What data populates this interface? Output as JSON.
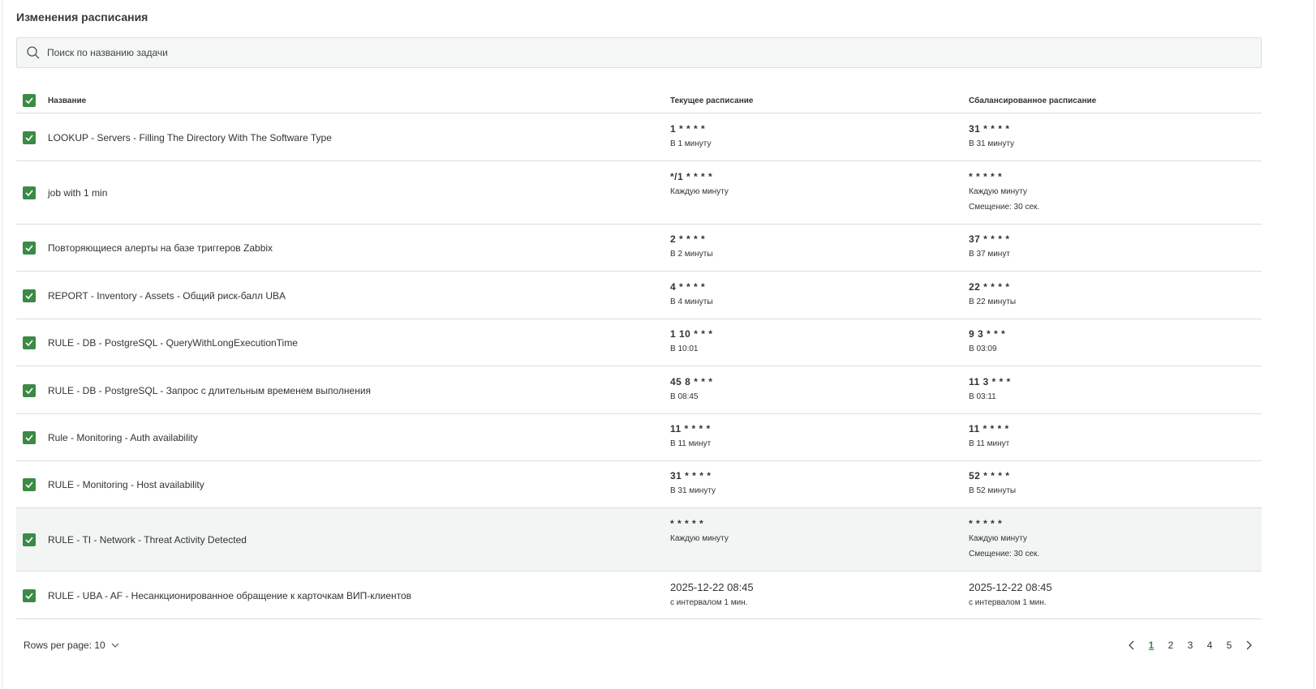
{
  "title": "Изменения расписания",
  "search": {
    "placeholder": "Поиск по названию задачи",
    "value": ""
  },
  "colors": {
    "accent": "#3b8a45"
  },
  "header": {
    "name": "Название",
    "current": "Текущее расписание",
    "balanced": "Сбалансированное расписание"
  },
  "rows": [
    {
      "name": "LOOKUP - Servers - Filling The Directory With The Software Type",
      "current": {
        "cron": "1 * * * *",
        "desc": "В 1 минуту"
      },
      "balanced": {
        "cron": "31 * * * *",
        "desc": "В 31 минуту"
      }
    },
    {
      "name": "job with 1 min",
      "current": {
        "cron": "*/1 * * * *",
        "desc": "Каждую минуту"
      },
      "balanced": {
        "cron": "* * * * *",
        "desc": "Каждую минуту",
        "offset": "Смещение: 30 сек."
      }
    },
    {
      "name": "Повторяющиеся алерты на базе триггеров Zabbix",
      "current": {
        "cron": "2 * * * *",
        "desc": "В 2 минуты"
      },
      "balanced": {
        "cron": "37 * * * *",
        "desc": "В 37 минут"
      }
    },
    {
      "name": "REPORT - Inventory - Assets - Общий риск-балл UBA",
      "current": {
        "cron": "4 * * * *",
        "desc": "В 4 минуты"
      },
      "balanced": {
        "cron": "22 * * * *",
        "desc": "В 22 минуты"
      }
    },
    {
      "name": "RULE - DB - PostgreSQL - QueryWithLongExecutionTime",
      "current": {
        "cron": "1 10 * * *",
        "desc": "В 10:01"
      },
      "balanced": {
        "cron": "9 3 * * *",
        "desc": "В 03:09"
      }
    },
    {
      "name": "RULE - DB - PostgreSQL - Запрос с длительным временем выполнения",
      "current": {
        "cron": "45 8 * * *",
        "desc": "В 08:45"
      },
      "balanced": {
        "cron": "11 3 * * *",
        "desc": "В 03:11"
      }
    },
    {
      "name": "Rule - Monitoring - Auth availability",
      "current": {
        "cron": "11 * * * *",
        "desc": "В 11 минут"
      },
      "balanced": {
        "cron": "11 * * * *",
        "desc": "В 11 минут"
      }
    },
    {
      "name": "RULE - Monitoring - Host availability",
      "current": {
        "cron": "31 * * * *",
        "desc": "В 31 минуту"
      },
      "balanced": {
        "cron": "52 * * * *",
        "desc": "В 52 минуты"
      }
    },
    {
      "name": "RULE - TI - Network - Threat Activity Detected",
      "current": {
        "cron": "* * * * *",
        "desc": "Каждую минуту"
      },
      "balanced": {
        "cron": "* * * * *",
        "desc": "Каждую минуту",
        "offset": "Смещение: 30 сек."
      }
    },
    {
      "name": "RULE - UBA - AF - Несанкционированное обращение к карточкам ВИП-клиентов",
      "current": {
        "cron": "2025-12-22 08:45",
        "desc": "с интервалом 1 мин."
      },
      "balanced": {
        "cron": "2025-12-22 08:45",
        "desc": "с интервалом 1 мин."
      }
    }
  ],
  "footer": {
    "rows_per_page": "Rows per page: 10",
    "pages": [
      "1",
      "2",
      "3",
      "4",
      "5"
    ],
    "current_page": "1"
  }
}
